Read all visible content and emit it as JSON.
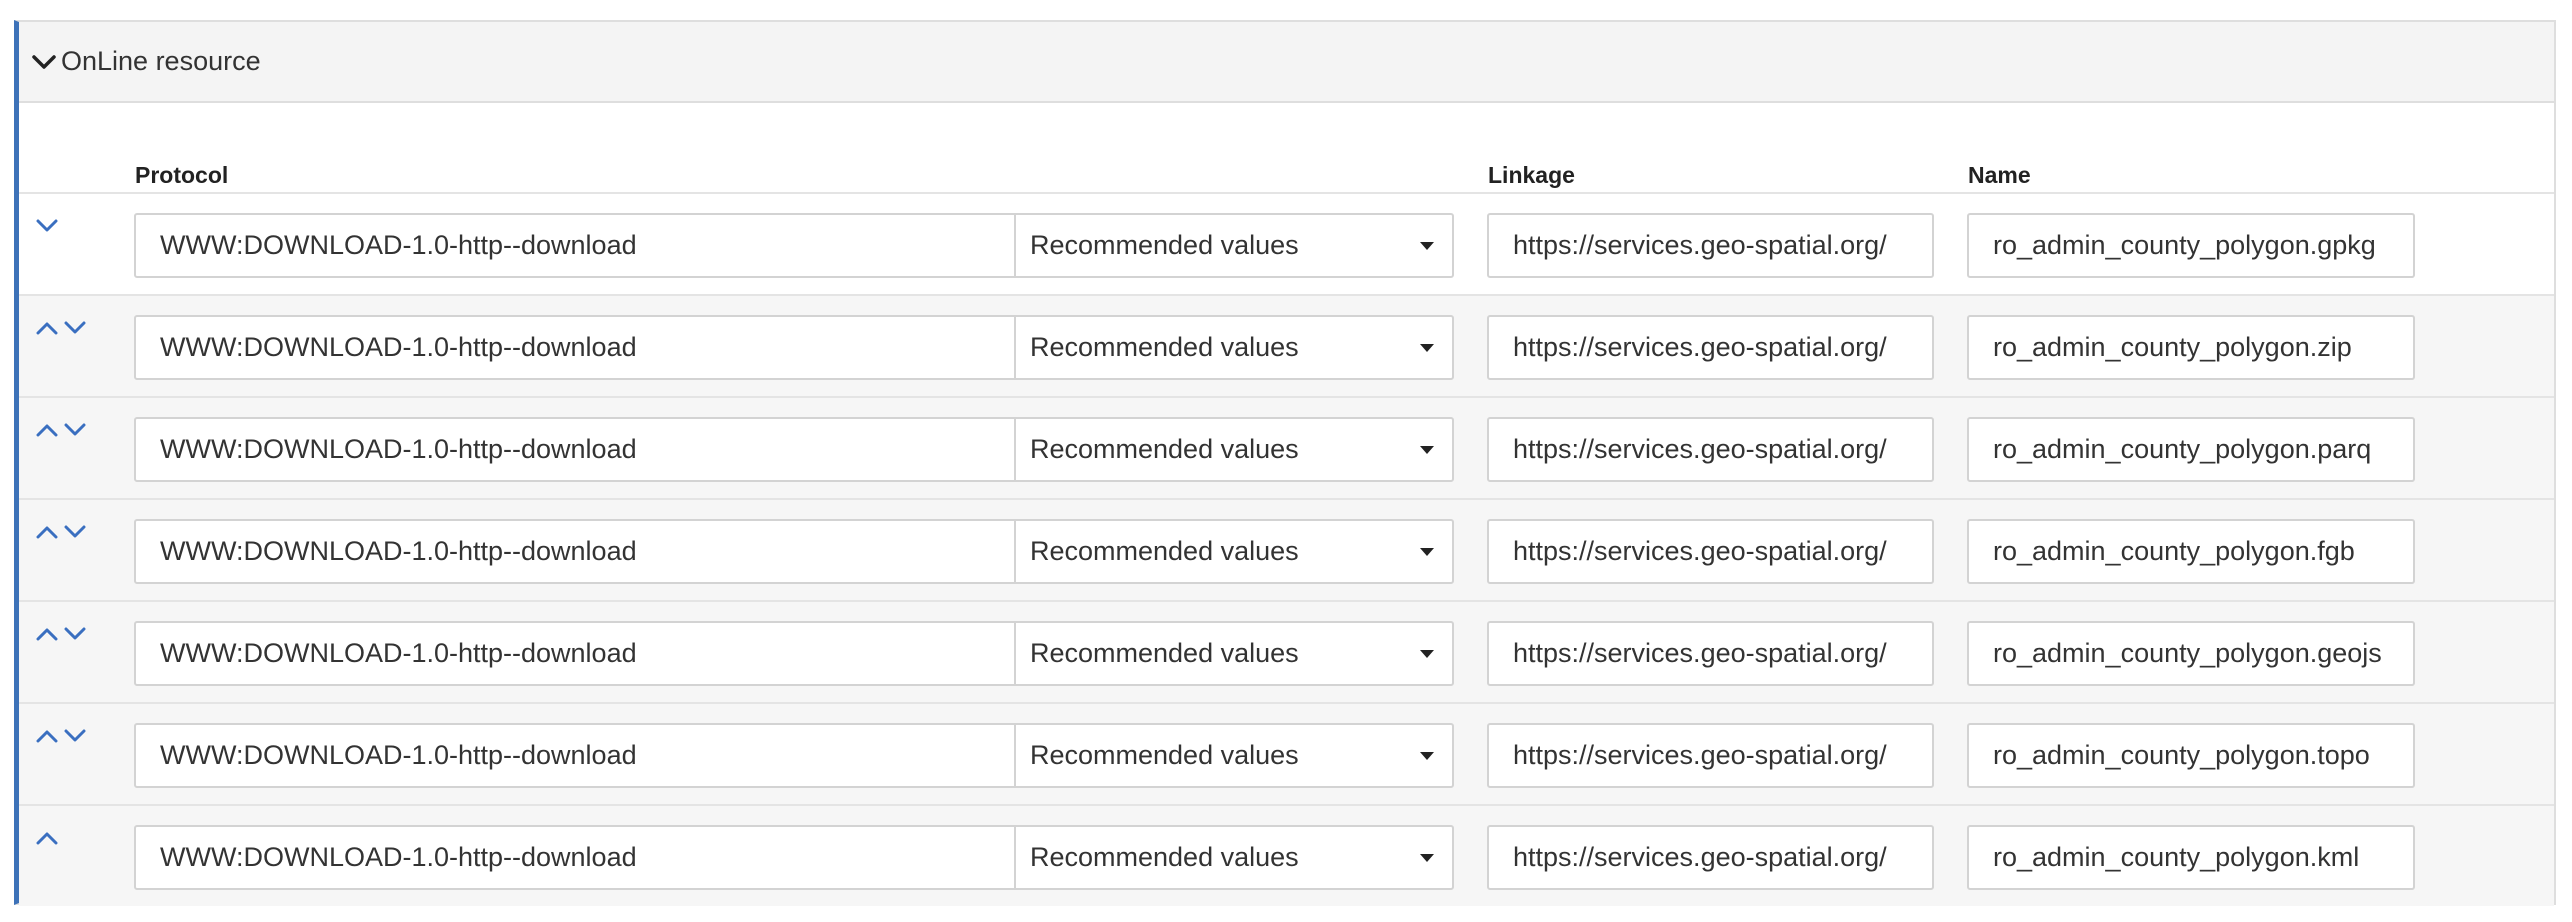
{
  "section": {
    "title": "OnLine resource"
  },
  "columns": {
    "protocol": "Protocol",
    "linkage": "Linkage",
    "name": "Name"
  },
  "rows": [
    {
      "protocol": "WWW:DOWNLOAD-1.0-http--download",
      "select": "Recommended values",
      "linkage": "https://services.geo-spatial.org/",
      "name": "ro_admin_county_polygon.gpkg",
      "move_up": false,
      "move_down": true
    },
    {
      "protocol": "WWW:DOWNLOAD-1.0-http--download",
      "select": "Recommended values",
      "linkage": "https://services.geo-spatial.org/",
      "name": "ro_admin_county_polygon.zip",
      "move_up": true,
      "move_down": true
    },
    {
      "protocol": "WWW:DOWNLOAD-1.0-http--download",
      "select": "Recommended values",
      "linkage": "https://services.geo-spatial.org/",
      "name": "ro_admin_county_polygon.parq",
      "move_up": true,
      "move_down": true
    },
    {
      "protocol": "WWW:DOWNLOAD-1.0-http--download",
      "select": "Recommended values",
      "linkage": "https://services.geo-spatial.org/",
      "name": "ro_admin_county_polygon.fgb",
      "move_up": true,
      "move_down": true
    },
    {
      "protocol": "WWW:DOWNLOAD-1.0-http--download",
      "select": "Recommended values",
      "linkage": "https://services.geo-spatial.org/",
      "name": "ro_admin_county_polygon.geojs",
      "move_up": true,
      "move_down": true
    },
    {
      "protocol": "WWW:DOWNLOAD-1.0-http--download",
      "select": "Recommended values",
      "linkage": "https://services.geo-spatial.org/",
      "name": "ro_admin_county_polygon.topo",
      "move_up": true,
      "move_down": true
    },
    {
      "protocol": "WWW:DOWNLOAD-1.0-http--download",
      "select": "Recommended values",
      "linkage": "https://services.geo-spatial.org/",
      "name": "ro_admin_county_polygon.kml",
      "move_up": true,
      "move_down": false
    }
  ],
  "colors": {
    "accent": "#3d72b8",
    "arrow": "#3a6fc0",
    "header_bg": "#f4f4f4",
    "row_alt_bg": "#f6f6f6"
  },
  "icons": {
    "collapse": "chevron-down-icon",
    "move_up": "chevron-up-icon",
    "move_down": "chevron-down-icon",
    "select_caret": "caret-down-icon"
  }
}
